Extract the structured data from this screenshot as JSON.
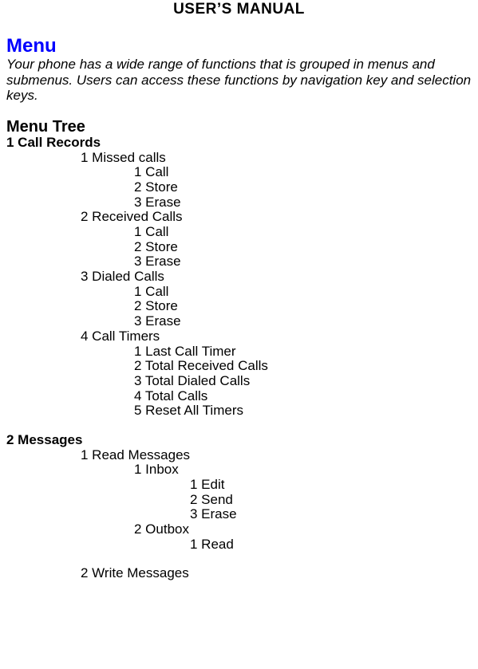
{
  "title": "USER’S MANUAL",
  "h1": "Menu",
  "intro": "Your phone has a wide range of functions that is grouped in menus and submenus.  Users can access these functions by navigation key and selection keys.",
  "h2": "Menu Tree",
  "tree": {
    "s1": {
      "head": "1 Call Records",
      "i1": {
        "label": "1 Missed calls",
        "a": "1 Call",
        "b": "2 Store",
        "c": "3 Erase"
      },
      "i2": {
        "label": "2 Received Calls",
        "a": "1 Call",
        "b": "2 Store",
        "c": "3 Erase"
      },
      "i3": {
        "label": "3 Dialed Calls",
        "a": "1 Call",
        "b": "2 Store",
        "c": "3 Erase"
      },
      "i4": {
        "label": "4 Call Timers",
        "a": "1 Last Call Timer",
        "b": "2 Total Received Calls",
        "c": "3 Total Dialed Calls",
        "d": "4 Total Calls",
        "e": "5 Reset All Timers"
      }
    },
    "s2": {
      "head": "2 Messages",
      "i1": {
        "label": "1 Read Messages",
        "c1": {
          "label": "1 Inbox",
          "a": "1 Edit",
          "b": "2 Send",
          "c": "3 Erase"
        },
        "c2": {
          "label": "2 Outbox",
          "a": "1 Read"
        }
      },
      "i2": {
        "label": "2 Write Messages"
      }
    }
  }
}
